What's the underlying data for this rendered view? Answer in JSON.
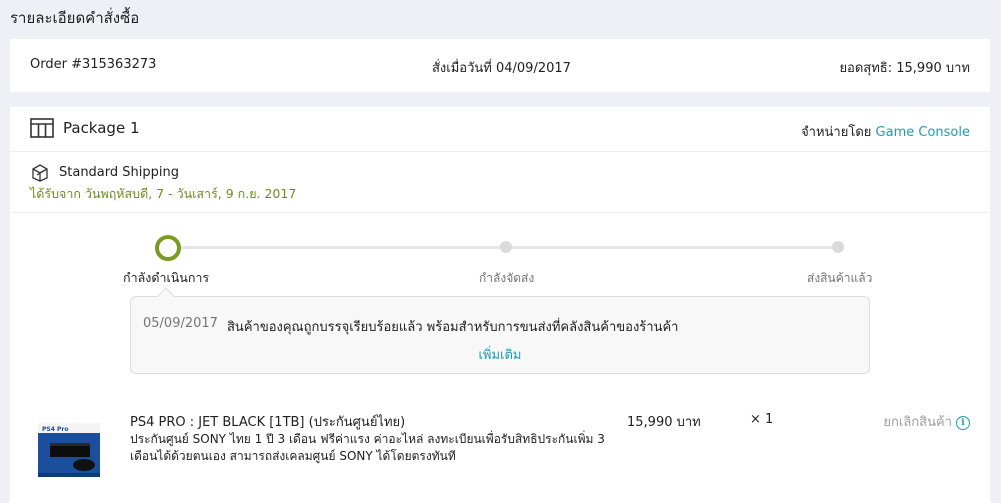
{
  "page": {
    "title": "รายละเอียดคำสั่งซื้อ"
  },
  "summary": {
    "order": "Order #315363273",
    "placed": "สั่งเมื่อวันที่ 04/09/2017",
    "total": "ยอดสุทธิ: 15,990 บาท"
  },
  "package": {
    "icon": "package-icon",
    "title": "Package 1",
    "seller_prefix": "จำหน่ายโดย",
    "seller": "Game Console",
    "shipping": {
      "icon": "shipping-box-icon",
      "method": "Standard Shipping",
      "eta": "ได้รับจาก วันพฤหัสบดี, 7 - วันเสาร์, 9 ก.ย. 2017"
    },
    "steps": [
      "กำลังดำเนินการ",
      "กำลังจัดส่ง",
      "ส่งสินค้าแล้ว"
    ],
    "active_step": 0,
    "update": {
      "date": "05/09/2017",
      "message": "สินค้าของคุณถูกบรรจุเรียบร้อยแล้ว พร้อมสำหรับการขนส่งที่คลังสินค้าของร้านค้า",
      "more": "เพิ่มเติม"
    },
    "item": {
      "image": "ps4-pro-box-image",
      "name": "PS4 PRO : JET BLACK [1TB] (ประกันศูนย์ไทย)",
      "description": "ประกันศูนย์ SONY ไทย 1 ปี 3 เดือน ฟรีค่าแรง ค่าอะไหล่ ลงทะเบียนเพื่อรับสิทธิประกันเพิ่ม 3 เดือนได้ด้วยตนเอง สามารถส่งเคลมศูนย์ SONY ได้โดยตรงทันที",
      "price": "15,990 บาท",
      "quantity": "× 1",
      "cancel": "ยกเลิกสินค้า",
      "info_icon": "info-icon"
    }
  },
  "colors": {
    "accent": "#1a9cb7",
    "eta_green": "#6e8b1e",
    "step_active": "#7a9a22"
  }
}
